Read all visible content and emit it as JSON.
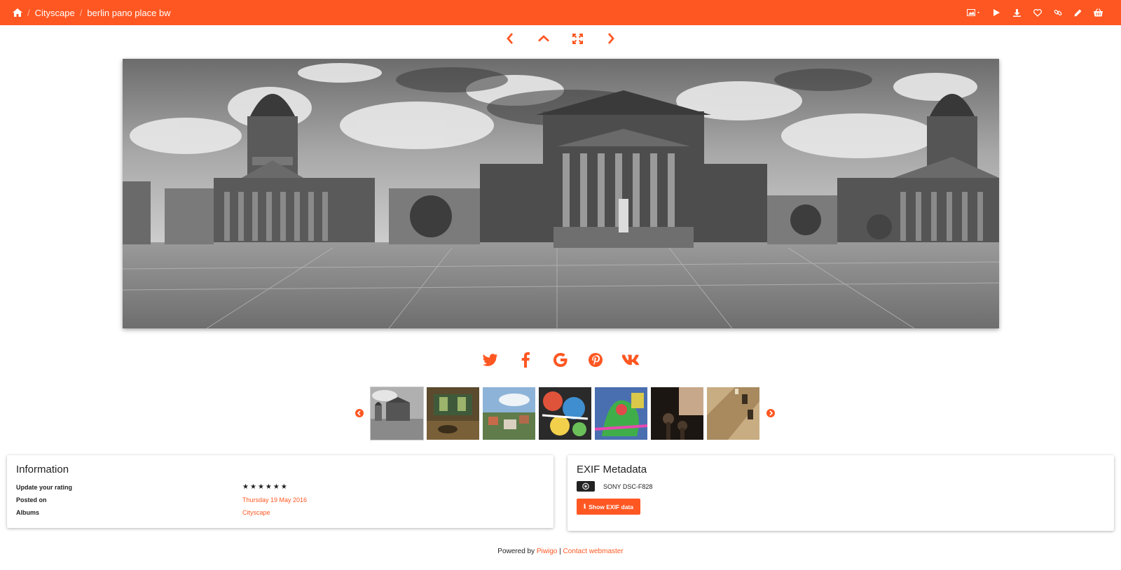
{
  "colors": {
    "accent": "#ff5722",
    "text": "#222222"
  },
  "breadcrumb": {
    "home_icon": "home-icon",
    "separator": "/",
    "album": "Cityscape",
    "photo": "berlin pano place bw"
  },
  "toolbar": {
    "icons": [
      "image-size-icon",
      "caret-down-icon",
      "play-icon",
      "download-icon",
      "heart-icon",
      "link-icon",
      "pencil-icon",
      "basket-icon"
    ]
  },
  "image_nav": {
    "icons": [
      "chevron-left-icon",
      "chevron-up-icon",
      "expand-icon",
      "chevron-right-icon"
    ]
  },
  "share": {
    "icons": [
      "twitter-icon",
      "facebook-icon",
      "google-icon",
      "pinterest-icon",
      "vk-icon"
    ]
  },
  "thumbnails": {
    "count": 7,
    "active_index": 0,
    "prev_icon": "circle-chevron-left-icon",
    "next_icon": "circle-chevron-right-icon"
  },
  "information": {
    "title": "Information",
    "rows": [
      {
        "label": "Update your rating",
        "value": ""
      },
      {
        "label": "Posted on",
        "value": "Thursday 19 May 2016"
      },
      {
        "label": "Albums",
        "value": "Cityscape"
      }
    ],
    "rating_stars": 6
  },
  "exif": {
    "title": "EXIF Metadata",
    "camera": "SONY DSC-F828",
    "button_label": "Show EXIF data",
    "button_icon": "info-icon"
  },
  "footer": {
    "powered_by": "Powered by",
    "piwigo": "Piwigo",
    "divider": "|",
    "contact": "Contact webmaster"
  }
}
